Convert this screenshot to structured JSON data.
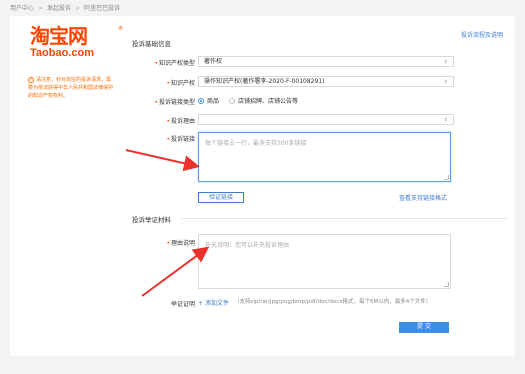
{
  "breadcrumb": [
    "用户中心",
    "发起投诉",
    "阿里巴巴投诉"
  ],
  "logo": {
    "cn": "淘宝网",
    "en": "Taobao.com",
    "reg": "®"
  },
  "notice": "请注意，针对淘宝的投诉请求，需要为依法获得中华人民共和国法律保护的知识产权权利。",
  "help_link": "投诉流程及说明",
  "section_basic": "投诉基础信息",
  "section_evidence": "投诉举证材料",
  "fields": {
    "ip_type": {
      "label": "知识产权类型",
      "value": "著作权"
    },
    "ip": {
      "label": "知识产权",
      "value": "操作知识产权(著作署李-2020-F-00108291)"
    },
    "link_type": {
      "label": "投诉链接类型",
      "options": [
        "商品",
        "店铺招牌、店铺公告等"
      ],
      "selected": "商品"
    },
    "reason": {
      "label": "投诉理由",
      "value": ""
    },
    "links": {
      "label": "投诉链接",
      "placeholder": "每个链接占一行，最多支持300条链接"
    },
    "desc": {
      "label": "理由说明",
      "placeholder": "补充说明：您可以补充投诉理由"
    },
    "proof": {
      "label": "举证证明"
    }
  },
  "verify_button": "验证链接",
  "supported_formats_link": "查看支持链接格式",
  "add_file": "添加文件",
  "attach_note": "（支持zip/rar/jpg/png/bmp/pdf/doc/docx格式，每个5M以内，最多4个文件）",
  "submit": "提 交",
  "colors": {
    "brand": "#ff4400",
    "accent": "#3a8ee6",
    "arrow": "#e8322b"
  }
}
